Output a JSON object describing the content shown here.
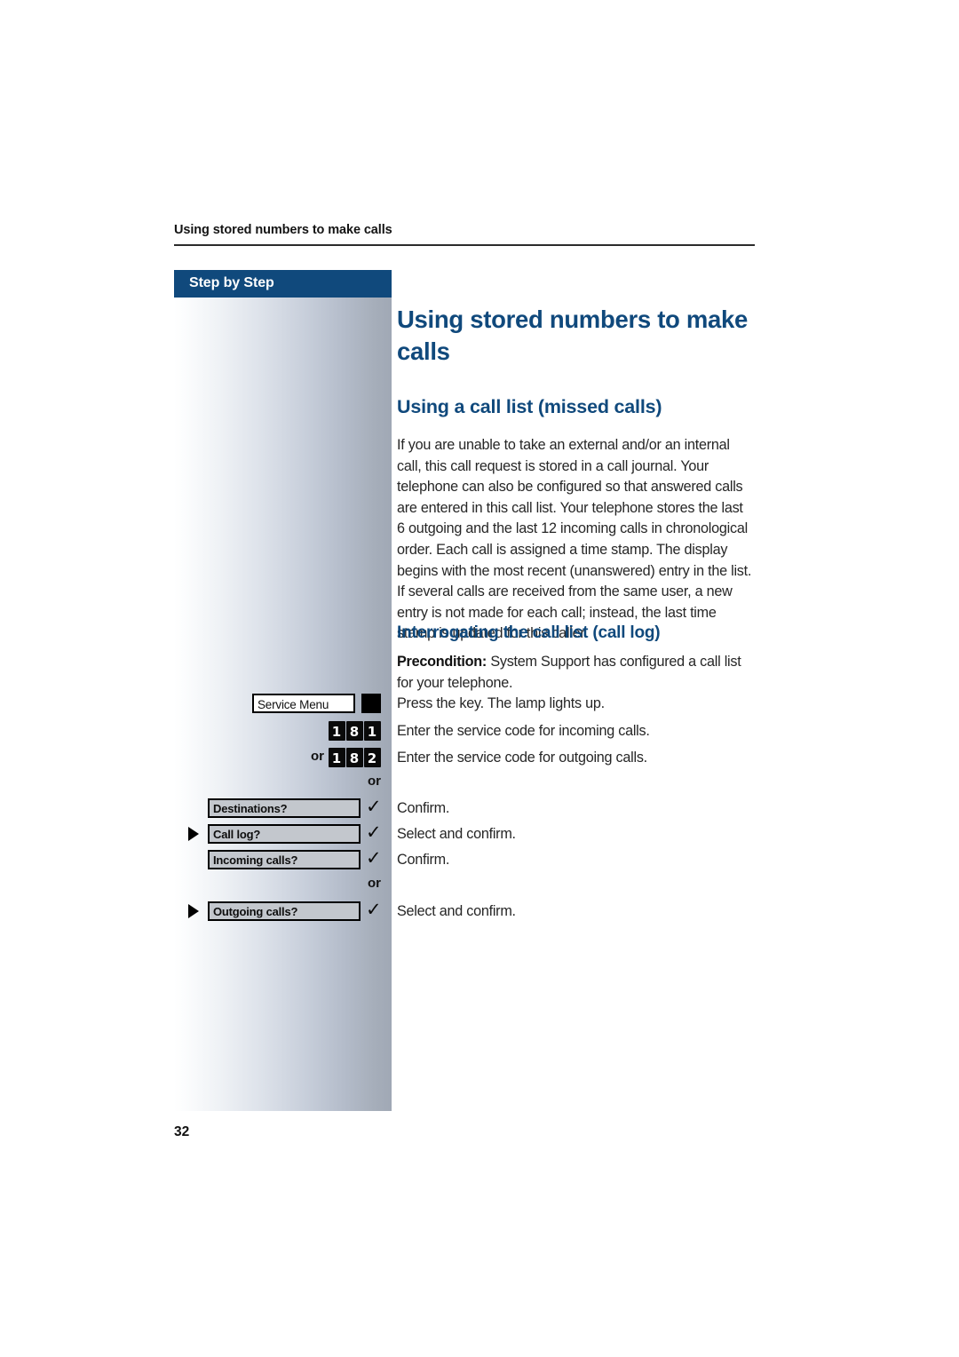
{
  "page": {
    "running_header": "Using stored numbers to make calls",
    "folio": "32",
    "accent_color": "#10497c",
    "text_color": "#262626"
  },
  "sidebar": {
    "tab_label": "Step by Step",
    "service_key": {
      "label": "Service Menu",
      "lamp_icon": "lamp-indicator"
    },
    "codes": [
      {
        "digits": [
          "1",
          "8",
          "1"
        ],
        "prefix": ""
      },
      {
        "digits": [
          "1",
          "8",
          "2"
        ],
        "prefix": "or"
      }
    ],
    "or_words": [
      {
        "text": "or"
      },
      {
        "text": "or"
      }
    ],
    "menu_rows": [
      {
        "label": "Destinations?",
        "has_arrow": false,
        "check": "✓"
      },
      {
        "label": "Call log?",
        "has_arrow": true,
        "check": "✓"
      },
      {
        "label": "Incoming calls?",
        "has_arrow": false,
        "check": "✓"
      },
      {
        "label": "Outgoing calls?",
        "has_arrow": true,
        "check": "✓"
      }
    ]
  },
  "content": {
    "title": "Using stored numbers to make calls",
    "subtitle": "Using a call list (missed calls)",
    "paragraph": "If you are unable to take an external and/or an internal call, this call request is stored in a call journal. Your telephone can also be configured so that answered calls are entered in this call list. Your telephone stores the last 6 outgoing and the last 12 incoming calls in chronological order. Each call is assigned a time stamp. The display begins with the most recent (unanswered) entry in the list. If several calls are received from the same user, a new entry is not made for each call; instead, the last time stamp is updated for this caller.",
    "subtitle2": "Interrogating the call list (call log)",
    "precondition_label": "Precondition:",
    "precondition_text": " System Support has configured a call list for your telephone.",
    "steps": [
      "Press the key. The lamp lights up.",
      "Enter the service code for incoming calls.",
      "Enter the service code for outgoing calls.",
      "Confirm.",
      "Select and confirm.",
      "Confirm.",
      "Select and confirm."
    ]
  }
}
